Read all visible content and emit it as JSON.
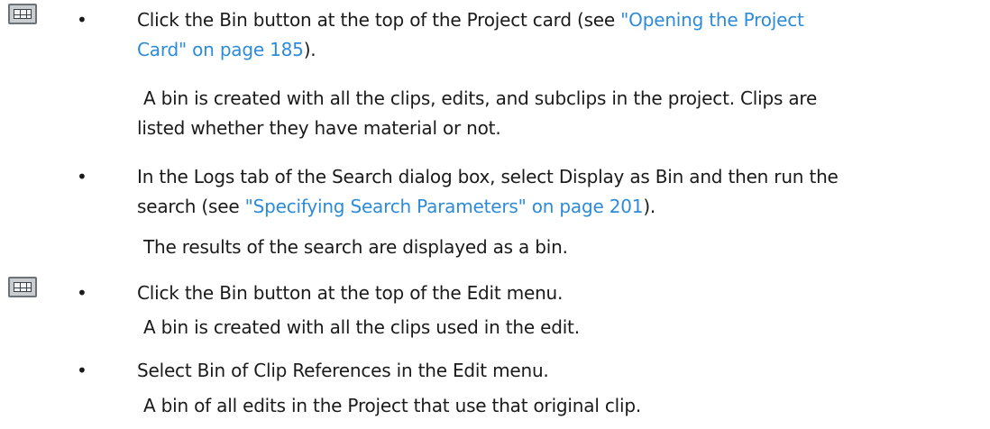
{
  "icons": [
    "bin-button-icon",
    "bin-button-icon"
  ],
  "bullet_char": "•",
  "items": [
    {
      "line1_pre": "Click the Bin button at the top of the Project card (see ",
      "line1_link": "\"Opening the Project",
      "line2_link": "Card\" on page 185",
      "line2_post": ").",
      "result_line1": "A bin is created with all the clips, edits, and subclips in the project. Clips are",
      "result_line2": "listed whether they have material or not."
    },
    {
      "line1": "In the Logs tab of the Search dialog box, select Display as Bin and then run the",
      "line2_pre": "search (see ",
      "line2_link": "\"Specifying Search Parameters\" on page 201",
      "line2_post": ").",
      "result": "The results of the search are displayed as a bin."
    },
    {
      "line1": "Click the Bin button at the top of the Edit menu.",
      "result": "A bin is created with all the clips used in the edit."
    },
    {
      "line1": "Select Bin of Clip References in the Edit menu.",
      "result": "A bin of all edits in the Project that use that original clip."
    }
  ],
  "colors": {
    "link": "#2d8bd9",
    "text": "#1a1a1a"
  }
}
